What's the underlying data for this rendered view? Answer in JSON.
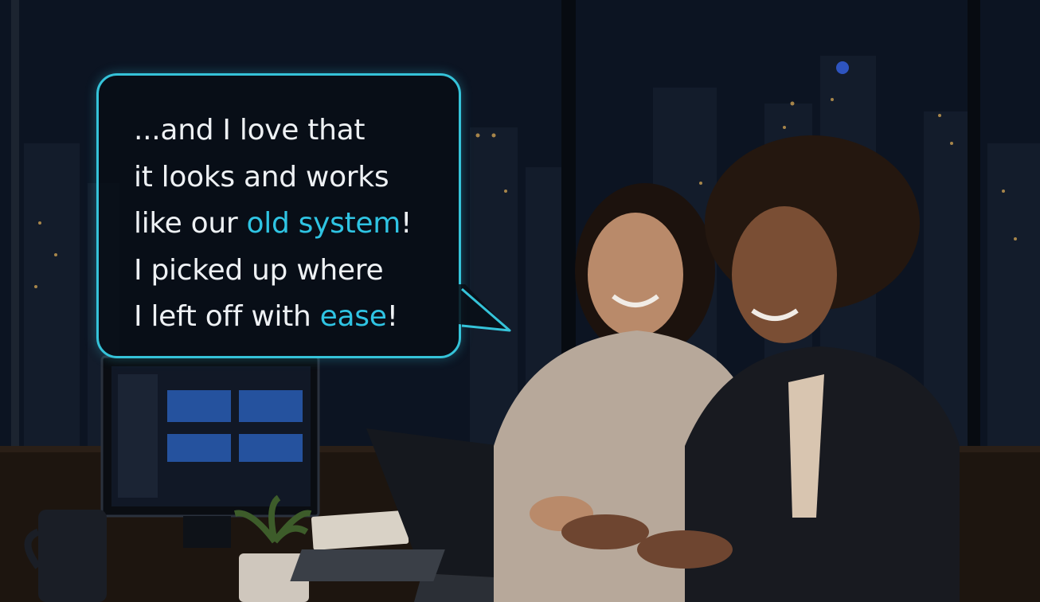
{
  "speech_bubble": {
    "lines": [
      {
        "parts": [
          {
            "text": "...and I love that",
            "highlight": false
          }
        ]
      },
      {
        "parts": [
          {
            "text": "it looks and works",
            "highlight": false
          }
        ]
      },
      {
        "parts": [
          {
            "text": "like our ",
            "highlight": false
          },
          {
            "text": "old system",
            "highlight": true
          },
          {
            "text": "!",
            "highlight": false
          }
        ]
      },
      {
        "parts": [
          {
            "text": "I picked up where",
            "highlight": false
          }
        ]
      },
      {
        "parts": [
          {
            "text": "I left off with ",
            "highlight": false
          },
          {
            "text": "ease",
            "highlight": true
          },
          {
            "text": "!",
            "highlight": false
          }
        ]
      }
    ]
  },
  "colors": {
    "accent": "#2fc4e3",
    "bubble_border": "#35c3d9",
    "text": "#eef1f4"
  }
}
